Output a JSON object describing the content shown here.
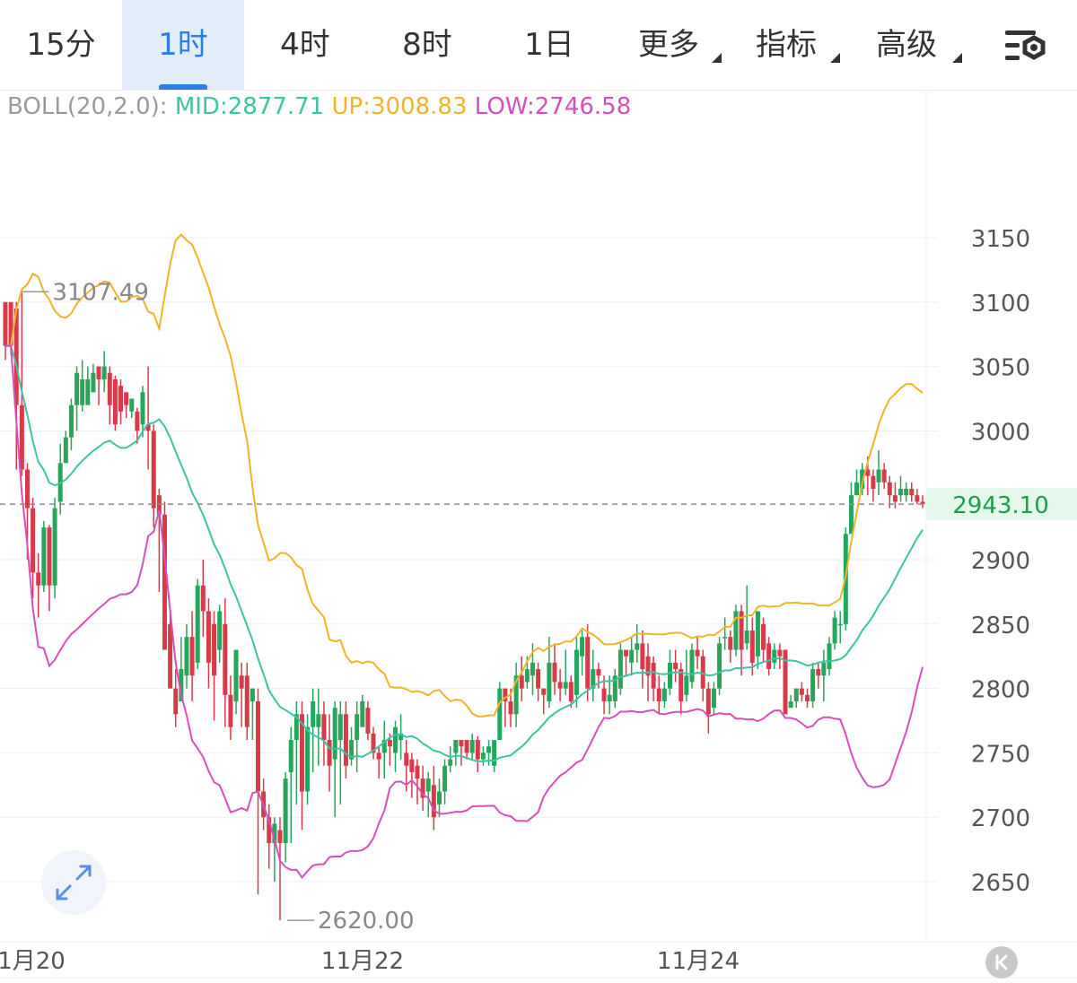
{
  "tabs": [
    {
      "label": "15分",
      "active": false,
      "dropdown": false
    },
    {
      "label": "1时",
      "active": true,
      "dropdown": false
    },
    {
      "label": "4时",
      "active": false,
      "dropdown": false
    },
    {
      "label": "8时",
      "active": false,
      "dropdown": false
    },
    {
      "label": "1日",
      "active": false,
      "dropdown": false
    },
    {
      "label": "更多",
      "active": false,
      "dropdown": true
    },
    {
      "label": "指标",
      "active": false,
      "dropdown": true
    },
    {
      "label": "高级",
      "active": false,
      "dropdown": true
    }
  ],
  "icons": {
    "settings": "chart-settings-icon",
    "zoom": "expand-arrows-icon",
    "scroll_end": "skip-to-latest-icon"
  },
  "colors": {
    "accent": "#2b7de9",
    "up_candle": "#26a65b",
    "down_candle": "#d93a4a",
    "mid": "#3ec4a2",
    "upper": "#f0b429",
    "lower": "#d94fb9",
    "price_tag": "#1a9f4d"
  },
  "indicator": {
    "label": "BOLL(20,2.0):",
    "mid": "MID:2877.71",
    "up": "UP:3008.83",
    "low": "LOW:2746.58"
  },
  "chart_data": {
    "type": "candlestick",
    "y_ticks": [
      3150,
      3100,
      3050,
      3000,
      2900,
      2850,
      2800,
      2750,
      2700,
      2650
    ],
    "x_ticks": [
      "1月20",
      "11月22",
      "11月24"
    ],
    "last_price": "2943.10",
    "high_marker": "3107.49",
    "low_marker": "2620.00",
    "grid": true,
    "candles": [
      [
        3066,
        3100,
        3100,
        3055
      ],
      [
        3066,
        3100,
        3066,
        3059
      ],
      [
        3020,
        3095,
        3100,
        2970
      ],
      [
        2970,
        3020,
        3108,
        2965
      ],
      [
        2940,
        2970,
        2975,
        2900
      ],
      [
        2890,
        2940,
        2948,
        2870
      ],
      [
        2880,
        2890,
        2905,
        2855
      ],
      [
        2925,
        2880,
        2930,
        2875
      ],
      [
        2880,
        2925,
        2927,
        2860
      ],
      [
        2940,
        2880,
        2948,
        2870
      ],
      [
        2975,
        2945,
        2990,
        2935
      ],
      [
        2995,
        2975,
        3000,
        2985
      ],
      [
        3020,
        2995,
        3025,
        2985
      ],
      [
        3045,
        3020,
        3050,
        3000
      ],
      [
        3040,
        3020,
        3055,
        3015
      ],
      [
        3040,
        3020,
        3050,
        3030
      ],
      [
        3045,
        3030,
        3052,
        3030
      ],
      [
        3040,
        3050,
        3050,
        3020
      ],
      [
        3050,
        3040,
        3062,
        3030
      ],
      [
        3020,
        3045,
        3050,
        3005
      ],
      [
        3005,
        3040,
        3043,
        3000
      ],
      [
        3015,
        3035,
        3040,
        3005
      ],
      [
        3020,
        3030,
        3030,
        3010
      ],
      [
        3025,
        3015,
        3025,
        3010
      ],
      [
        3000,
        3015,
        3018,
        2990
      ],
      [
        3030,
        3005,
        3035,
        2995
      ],
      [
        3000,
        3005,
        3050,
        2970
      ],
      [
        2940,
        3000,
        3005,
        2925
      ],
      [
        2935,
        2950,
        2955,
        2875
      ],
      [
        2830,
        2935,
        2945,
        2840
      ],
      [
        2800,
        2850,
        2860,
        2800
      ],
      [
        2780,
        2800,
        2815,
        2770
      ],
      [
        2815,
        2790,
        2840,
        2790
      ],
      [
        2840,
        2810,
        2850,
        2800
      ],
      [
        2810,
        2840,
        2860,
        2790
      ],
      [
        2880,
        2820,
        2885,
        2815
      ],
      [
        2860,
        2880,
        2900,
        2840
      ],
      [
        2820,
        2860,
        2870,
        2800
      ],
      [
        2810,
        2850,
        2860,
        2775
      ],
      [
        2860,
        2830,
        2865,
        2820
      ],
      [
        2795,
        2850,
        2870,
        2770
      ],
      [
        2770,
        2795,
        2810,
        2760
      ],
      [
        2830,
        2790,
        2830,
        2780
      ],
      [
        2800,
        2810,
        2820,
        2770
      ],
      [
        2770,
        2810,
        2820,
        2760
      ],
      [
        2800,
        2790,
        2800,
        2760
      ],
      [
        2720,
        2790,
        2800,
        2640
      ],
      [
        2700,
        2720,
        2730,
        2690
      ],
      [
        2680,
        2700,
        2710,
        2660
      ],
      [
        2695,
        2680,
        2700,
        2650
      ],
      [
        2680,
        2690,
        2700,
        2620
      ],
      [
        2730,
        2680,
        2735,
        2665
      ],
      [
        2760,
        2735,
        2770,
        2680
      ],
      [
        2780,
        2760,
        2790,
        2710
      ],
      [
        2720,
        2780,
        2790,
        2690
      ],
      [
        2770,
        2720,
        2780,
        2710
      ],
      [
        2790,
        2770,
        2800,
        2735
      ],
      [
        2780,
        2770,
        2800,
        2740
      ],
      [
        2760,
        2780,
        2790,
        2740
      ],
      [
        2740,
        2760,
        2780,
        2720
      ],
      [
        2785,
        2745,
        2790,
        2700
      ],
      [
        2780,
        2760,
        2790,
        2710
      ],
      [
        2740,
        2780,
        2790,
        2730
      ],
      [
        2760,
        2745,
        2770,
        2740
      ],
      [
        2780,
        2760,
        2790,
        2735
      ],
      [
        2790,
        2770,
        2795,
        2780
      ],
      [
        2765,
        2785,
        2790,
        2760
      ],
      [
        2750,
        2765,
        2770,
        2745
      ],
      [
        2745,
        2750,
        2755,
        2730
      ],
      [
        2760,
        2750,
        2775,
        2730
      ],
      [
        2755,
        2760,
        2765,
        2740
      ],
      [
        2770,
        2750,
        2775,
        2735
      ],
      [
        2765,
        2760,
        2780,
        2745
      ],
      [
        2740,
        2750,
        2760,
        2720
      ],
      [
        2735,
        2745,
        2750,
        2715
      ],
      [
        2730,
        2740,
        2745,
        2710
      ],
      [
        2715,
        2730,
        2740,
        2705
      ],
      [
        2730,
        2720,
        2735,
        2700
      ],
      [
        2700,
        2725,
        2740,
        2690
      ],
      [
        2720,
        2710,
        2730,
        2700
      ],
      [
        2740,
        2720,
        2745,
        2710
      ],
      [
        2745,
        2740,
        2755,
        2735
      ],
      [
        2760,
        2750,
        2760,
        2740
      ],
      [
        2755,
        2760,
        2760,
        2740
      ],
      [
        2750,
        2760,
        2760,
        2745
      ],
      [
        2760,
        2750,
        2765,
        2745
      ],
      [
        2745,
        2760,
        2763,
        2735
      ],
      [
        2750,
        2745,
        2755,
        2740
      ],
      [
        2755,
        2750,
        2760,
        2740
      ],
      [
        2760,
        2740,
        2760,
        2735
      ],
      [
        2800,
        2760,
        2805,
        2760
      ],
      [
        2790,
        2800,
        2800,
        2770
      ],
      [
        2780,
        2790,
        2800,
        2770
      ],
      [
        2810,
        2780,
        2820,
        2770
      ],
      [
        2800,
        2810,
        2825,
        2790
      ],
      [
        2815,
        2805,
        2825,
        2800
      ],
      [
        2820,
        2810,
        2835,
        2795
      ],
      [
        2800,
        2815,
        2820,
        2790
      ],
      [
        2795,
        2800,
        2800,
        2780
      ],
      [
        2820,
        2790,
        2840,
        2785
      ],
      [
        2805,
        2820,
        2835,
        2795
      ],
      [
        2800,
        2805,
        2815,
        2790
      ],
      [
        2805,
        2800,
        2830,
        2795
      ],
      [
        2790,
        2805,
        2810,
        2785
      ],
      [
        2830,
        2795,
        2840,
        2785
      ],
      [
        2840,
        2825,
        2845,
        2810
      ],
      [
        2800,
        2840,
        2850,
        2790
      ],
      [
        2815,
        2800,
        2830,
        2790
      ],
      [
        2810,
        2815,
        2820,
        2800
      ],
      [
        2790,
        2800,
        2810,
        2780
      ],
      [
        2795,
        2790,
        2810,
        2780
      ],
      [
        2810,
        2790,
        2815,
        2785
      ],
      [
        2830,
        2800,
        2835,
        2795
      ],
      [
        2825,
        2830,
        2830,
        2810
      ],
      [
        2830,
        2820,
        2840,
        2810
      ],
      [
        2835,
        2830,
        2850,
        2820
      ],
      [
        2815,
        2835,
        2845,
        2800
      ],
      [
        2810,
        2825,
        2835,
        2790
      ],
      [
        2800,
        2820,
        2825,
        2790
      ],
      [
        2790,
        2800,
        2810,
        2780
      ],
      [
        2800,
        2790,
        2805,
        2785
      ],
      [
        2820,
        2800,
        2830,
        2795
      ],
      [
        2815,
        2820,
        2830,
        2805
      ],
      [
        2790,
        2815,
        2820,
        2780
      ],
      [
        2810,
        2795,
        2830,
        2790
      ],
      [
        2830,
        2805,
        2835,
        2800
      ],
      [
        2825,
        2830,
        2840,
        2815
      ],
      [
        2800,
        2825,
        2830,
        2790
      ],
      [
        2780,
        2800,
        2805,
        2765
      ],
      [
        2800,
        2785,
        2805,
        2780
      ],
      [
        2835,
        2800,
        2840,
        2795
      ],
      [
        2840,
        2840,
        2855,
        2830
      ],
      [
        2830,
        2840,
        2845,
        2820
      ],
      [
        2860,
        2830,
        2865,
        2825
      ],
      [
        2830,
        2860,
        2865,
        2810
      ],
      [
        2845,
        2835,
        2880,
        2830
      ],
      [
        2820,
        2845,
        2855,
        2810
      ],
      [
        2860,
        2825,
        2860,
        2815
      ],
      [
        2830,
        2850,
        2855,
        2820
      ],
      [
        2815,
        2835,
        2840,
        2810
      ],
      [
        2830,
        2820,
        2835,
        2815
      ],
      [
        2825,
        2830,
        2835,
        2815
      ],
      [
        2780,
        2830,
        2830,
        2780
      ],
      [
        2790,
        2785,
        2795,
        2785
      ],
      [
        2800,
        2790,
        2800,
        2785
      ],
      [
        2795,
        2800,
        2805,
        2790
      ],
      [
        2790,
        2795,
        2800,
        2785
      ],
      [
        2815,
        2790,
        2820,
        2785
      ],
      [
        2810,
        2815,
        2820,
        2800
      ],
      [
        2820,
        2810,
        2830,
        2790
      ],
      [
        2835,
        2815,
        2840,
        2810
      ],
      [
        2855,
        2835,
        2860,
        2830
      ],
      [
        2850,
        2850,
        2860,
        2835
      ],
      [
        2920,
        2850,
        2925,
        2845
      ],
      [
        2950,
        2920,
        2960,
        2930
      ],
      [
        2960,
        2950,
        2970,
        2950
      ],
      [
        2970,
        2955,
        2975,
        2950
      ],
      [
        2965,
        2970,
        2980,
        2950
      ],
      [
        2955,
        2965,
        2970,
        2945
      ],
      [
        2970,
        2960,
        2985,
        2950
      ],
      [
        2960,
        2970,
        2975,
        2955
      ],
      [
        2950,
        2960,
        2965,
        2940
      ],
      [
        2945,
        2950,
        2960,
        2940
      ],
      [
        2955,
        2950,
        2965,
        2945
      ],
      [
        2955,
        2950,
        2960,
        2945
      ],
      [
        2950,
        2955,
        2960,
        2945
      ],
      [
        2945,
        2950,
        2955,
        2943
      ],
      [
        2943,
        2945,
        2950,
        2940
      ]
    ]
  }
}
